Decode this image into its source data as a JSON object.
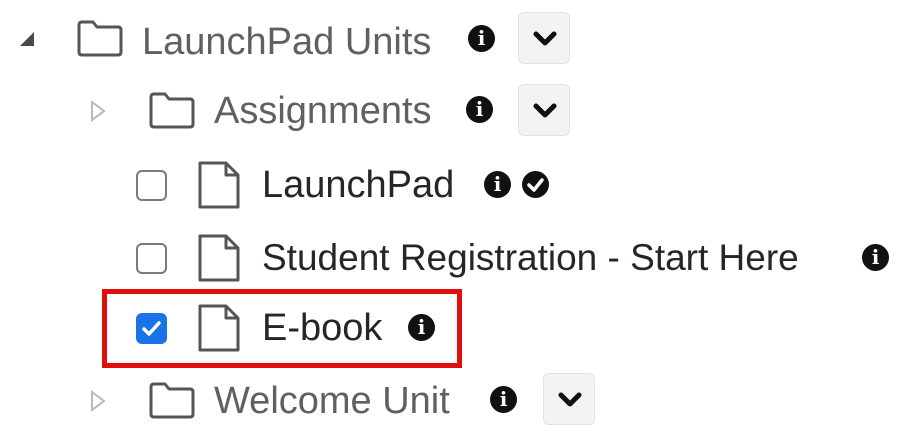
{
  "tree": {
    "root": {
      "label": "LaunchPad Units",
      "expanded": true
    },
    "assignments": {
      "label": "Assignments",
      "expanded": false
    },
    "items": [
      {
        "label": "LaunchPad",
        "checked": false,
        "completed": true
      },
      {
        "label": "Student Registration - Start Here",
        "checked": false,
        "completed": false
      },
      {
        "label": "E-book",
        "checked": true,
        "completed": false
      }
    ],
    "welcome": {
      "label": "Welcome Unit",
      "expanded": false
    }
  },
  "icons": {
    "info": "i",
    "caret_open": "caret-down-right-icon",
    "caret_closed": "caret-right-icon",
    "folder": "folder-icon",
    "file": "file-icon",
    "dropdown": "chevron-down-icon",
    "completed": "check-circle-icon"
  },
  "colors": {
    "highlight": "#e10e0e",
    "checkbox_checked": "#1a73e8"
  }
}
